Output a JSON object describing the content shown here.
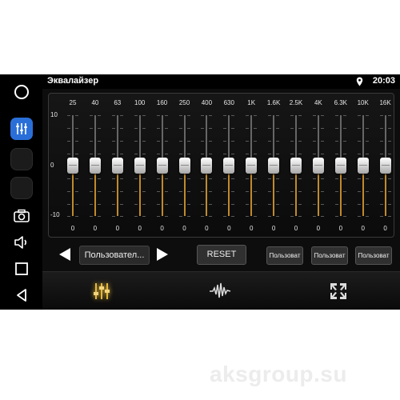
{
  "header": {
    "title": "Эквалайзер",
    "time": "20:03"
  },
  "equalizer": {
    "bands": [
      "25",
      "40",
      "63",
      "100",
      "160",
      "250",
      "400",
      "630",
      "1K",
      "1.6K",
      "2.5K",
      "4K",
      "6.3K",
      "10K",
      "16K"
    ],
    "values": [
      "0",
      "0",
      "0",
      "0",
      "0",
      "0",
      "0",
      "0",
      "0",
      "0",
      "0",
      "0",
      "0",
      "0",
      "0"
    ],
    "scale": {
      "max_label": "10",
      "mid_label": "0",
      "min_label": "-10",
      "max": 10,
      "min": -10
    }
  },
  "controls": {
    "preset_label": "Пользовател...",
    "reset_label": "RESET",
    "user_presets": [
      "Пользоват",
      "Пользоват",
      "Пользоват"
    ]
  },
  "colors": {
    "accent_blue": "#2a6fd8",
    "slider_gold": "#c08a2a",
    "tab_active_gold": "#e5b93a"
  },
  "icons": {
    "sidebar": [
      "circle-home-icon",
      "equalizer-icon",
      "camera-icon",
      "volume-icon",
      "square-icon",
      "triangle-back-icon"
    ],
    "tabs": [
      "equalizer-sliders-icon",
      "waveform-icon",
      "balance-fader-icon"
    ],
    "status": "location-pin-icon"
  },
  "watermark": "aksgroup.su"
}
